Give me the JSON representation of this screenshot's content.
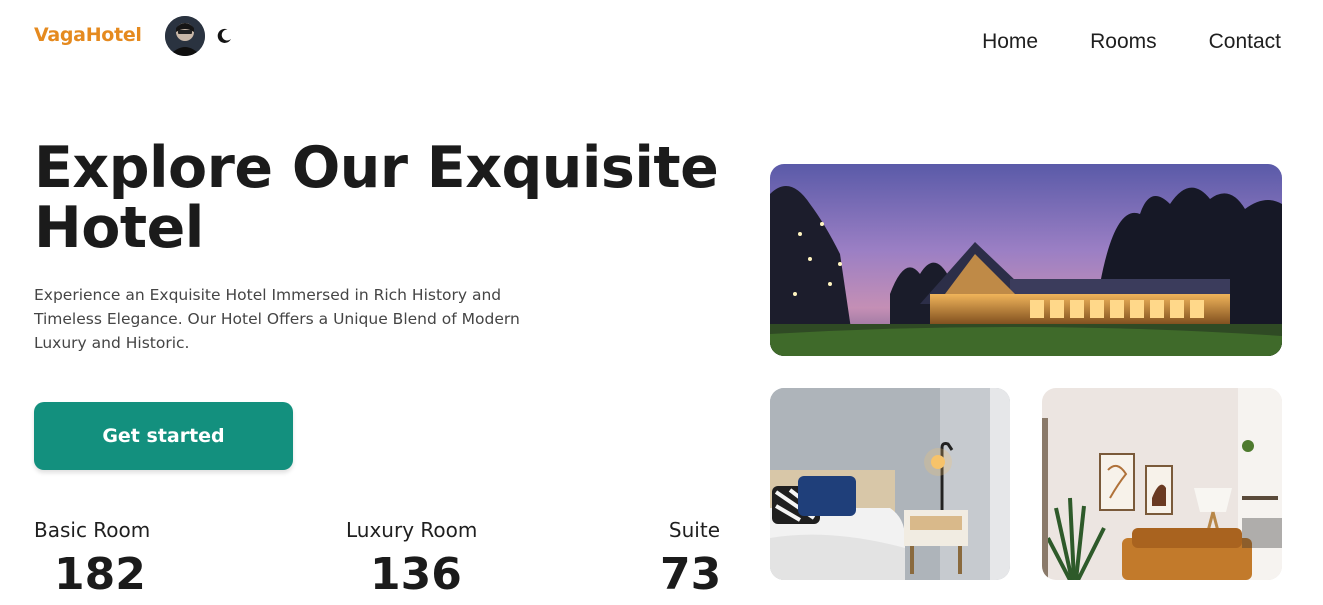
{
  "header": {
    "brand": "VagaHotel",
    "nav": [
      "Home",
      "Rooms",
      "Contact"
    ]
  },
  "hero": {
    "title": "Explore Our Exquisite Hotel",
    "description": "Experience an Exquisite Hotel Immersed in Rich History and Timeless Elegance. Our Hotel Offers a Unique Blend of Modern Luxury and Historic.",
    "cta": "Get started"
  },
  "stats": [
    {
      "label": "Basic Room",
      "value": "182"
    },
    {
      "label": "Luxury Room",
      "value": "136"
    },
    {
      "label": "Suite",
      "value": "73"
    }
  ],
  "icons": {
    "avatar": "user-avatar",
    "theme": "moon-icon"
  },
  "colors": {
    "brand": "#e58a1f",
    "accent": "#13907e",
    "text": "#1b1b1b"
  }
}
